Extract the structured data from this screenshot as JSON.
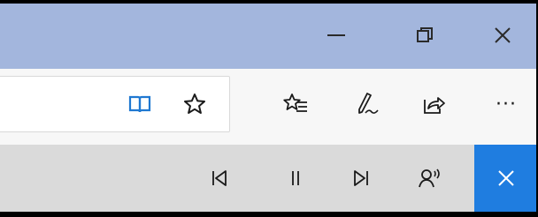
{
  "window": {
    "caption_buttons": [
      {
        "name": "minimize",
        "icon": "minimize-icon"
      },
      {
        "name": "restore",
        "icon": "restore-icon"
      },
      {
        "name": "close",
        "icon": "close-icon"
      }
    ],
    "titlebar_color": "#a3b6dd"
  },
  "toolbar": {
    "address_value": "",
    "icons": [
      "reading-view-icon",
      "add-favorite-star-icon",
      "favorites-hub-icon",
      "web-note-pen-icon",
      "share-icon",
      "more-ellipsis-icon"
    ],
    "more_label": "···",
    "accent_color": "#1f78d1"
  },
  "read_aloud": {
    "controls": [
      "previous-paragraph-icon",
      "pause-icon",
      "next-paragraph-icon",
      "voice-settings-icon"
    ],
    "close_color": "#1f7de0"
  }
}
